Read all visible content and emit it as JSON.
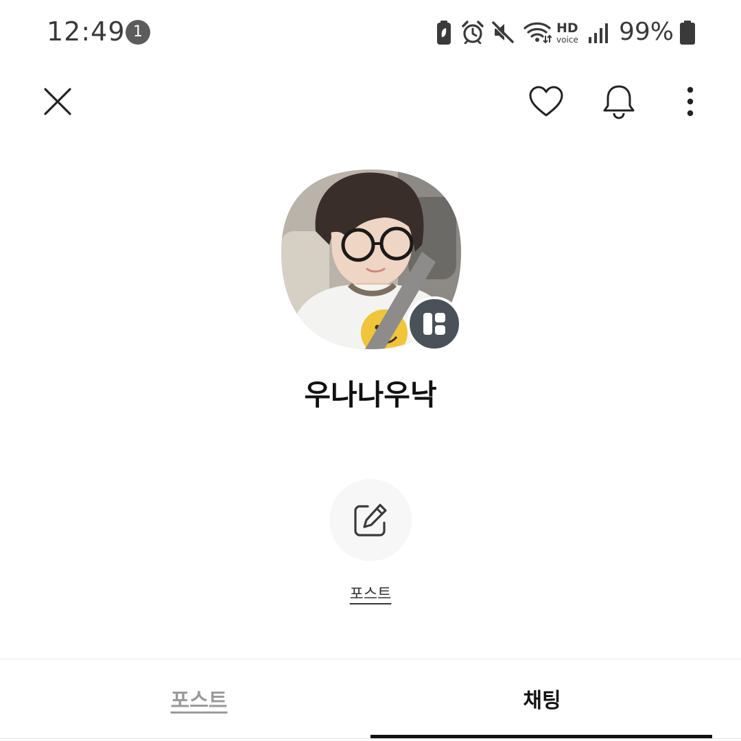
{
  "status_bar": {
    "time": "12:49",
    "notification_count": "1",
    "network_hd": "HD",
    "network_voice": "voice",
    "battery_percent": "99%",
    "icons": [
      "battery-saver-icon",
      "alarm-icon",
      "mute-icon",
      "wifi-icon",
      "hd-voice-icon",
      "signal-icon",
      "battery-icon"
    ]
  },
  "top_bar": {
    "icons": [
      "close-icon",
      "heart-icon",
      "bell-icon",
      "more-vertical-icon"
    ]
  },
  "profile": {
    "name": "우나나우낙",
    "avatar": "profile-photo",
    "badge_icon": "profile-grid-icon"
  },
  "actions": {
    "post_label": "포스트",
    "post_icon": "edit-icon"
  },
  "tabs": [
    {
      "label": "포스트",
      "selected": false
    },
    {
      "label": "채팅",
      "selected": true
    }
  ],
  "colors": {
    "badge": "#4a5159",
    "text": "#111111",
    "muted": "#9a9a9a",
    "indicator": "#111111"
  }
}
